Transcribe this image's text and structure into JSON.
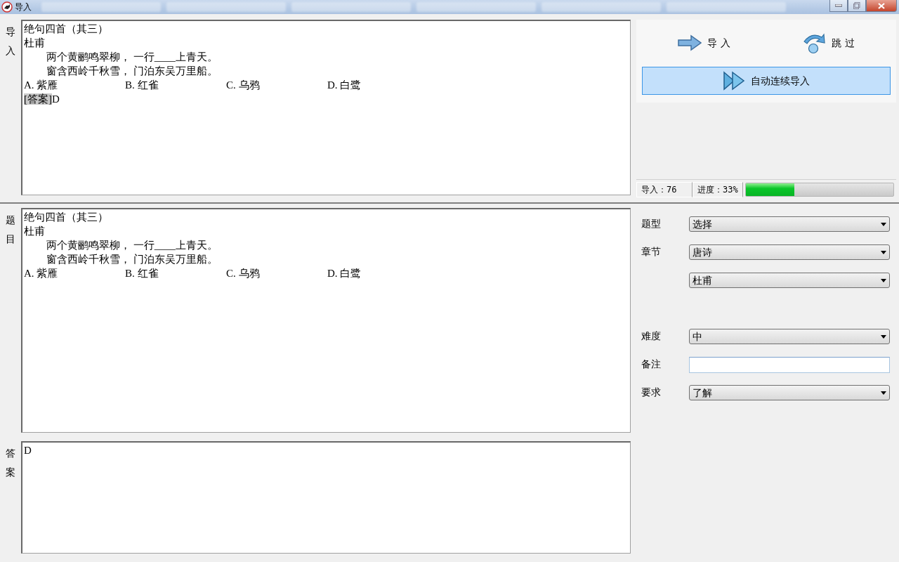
{
  "window": {
    "title": "导入"
  },
  "import_panel": {
    "label": "导入",
    "document": {
      "title": "绝句四首（其三）",
      "author": "杜甫",
      "lines": [
        "两个黄鹂鸣翠柳， 一行____上青天。",
        "窗含西岭千秋雪， 门泊东吴万里船。"
      ],
      "options": [
        "A. 紫雁",
        "B. 红雀",
        "C. 乌鸦",
        "D. 白鹭"
      ],
      "answer": {
        "tag": "[答案]",
        "value": "D"
      }
    }
  },
  "actions": [
    {
      "kind": "import",
      "label": "导 入",
      "selected": false
    },
    {
      "kind": "skip",
      "label": "跳 过",
      "selected": false
    },
    {
      "kind": "auto",
      "label": "自动连续导入",
      "selected": true
    }
  ],
  "status": {
    "imported": "导入：76",
    "progress": "进度：33%",
    "level": 0.33
  },
  "question_panel": {
    "label": "题目",
    "document": {
      "title": "绝句四首（其三）",
      "author": "杜甫",
      "lines": [
        "两个黄鹂鸣翠柳， 一行____上青天。",
        "窗含西岭千秋雪， 门泊东吴万里船。"
      ],
      "options": [
        "A. 紫雁",
        "B. 红雀",
        "C. 乌鸦",
        "D. 白鹭"
      ]
    }
  },
  "answer_panel": {
    "label": "答案",
    "text": "D"
  },
  "form": [
    {
      "label": "题型",
      "kind": "select",
      "value": "选择"
    },
    {
      "label": "章节",
      "kind": "select",
      "value": "唐诗"
    },
    {
      "kind": "select",
      "value": "杜甫"
    },
    {
      "label": "难度",
      "kind": "select",
      "value": "中"
    },
    {
      "label": "备注",
      "kind": "text"
    },
    {
      "label": "要求",
      "kind": "select",
      "value": "了解"
    }
  ]
}
